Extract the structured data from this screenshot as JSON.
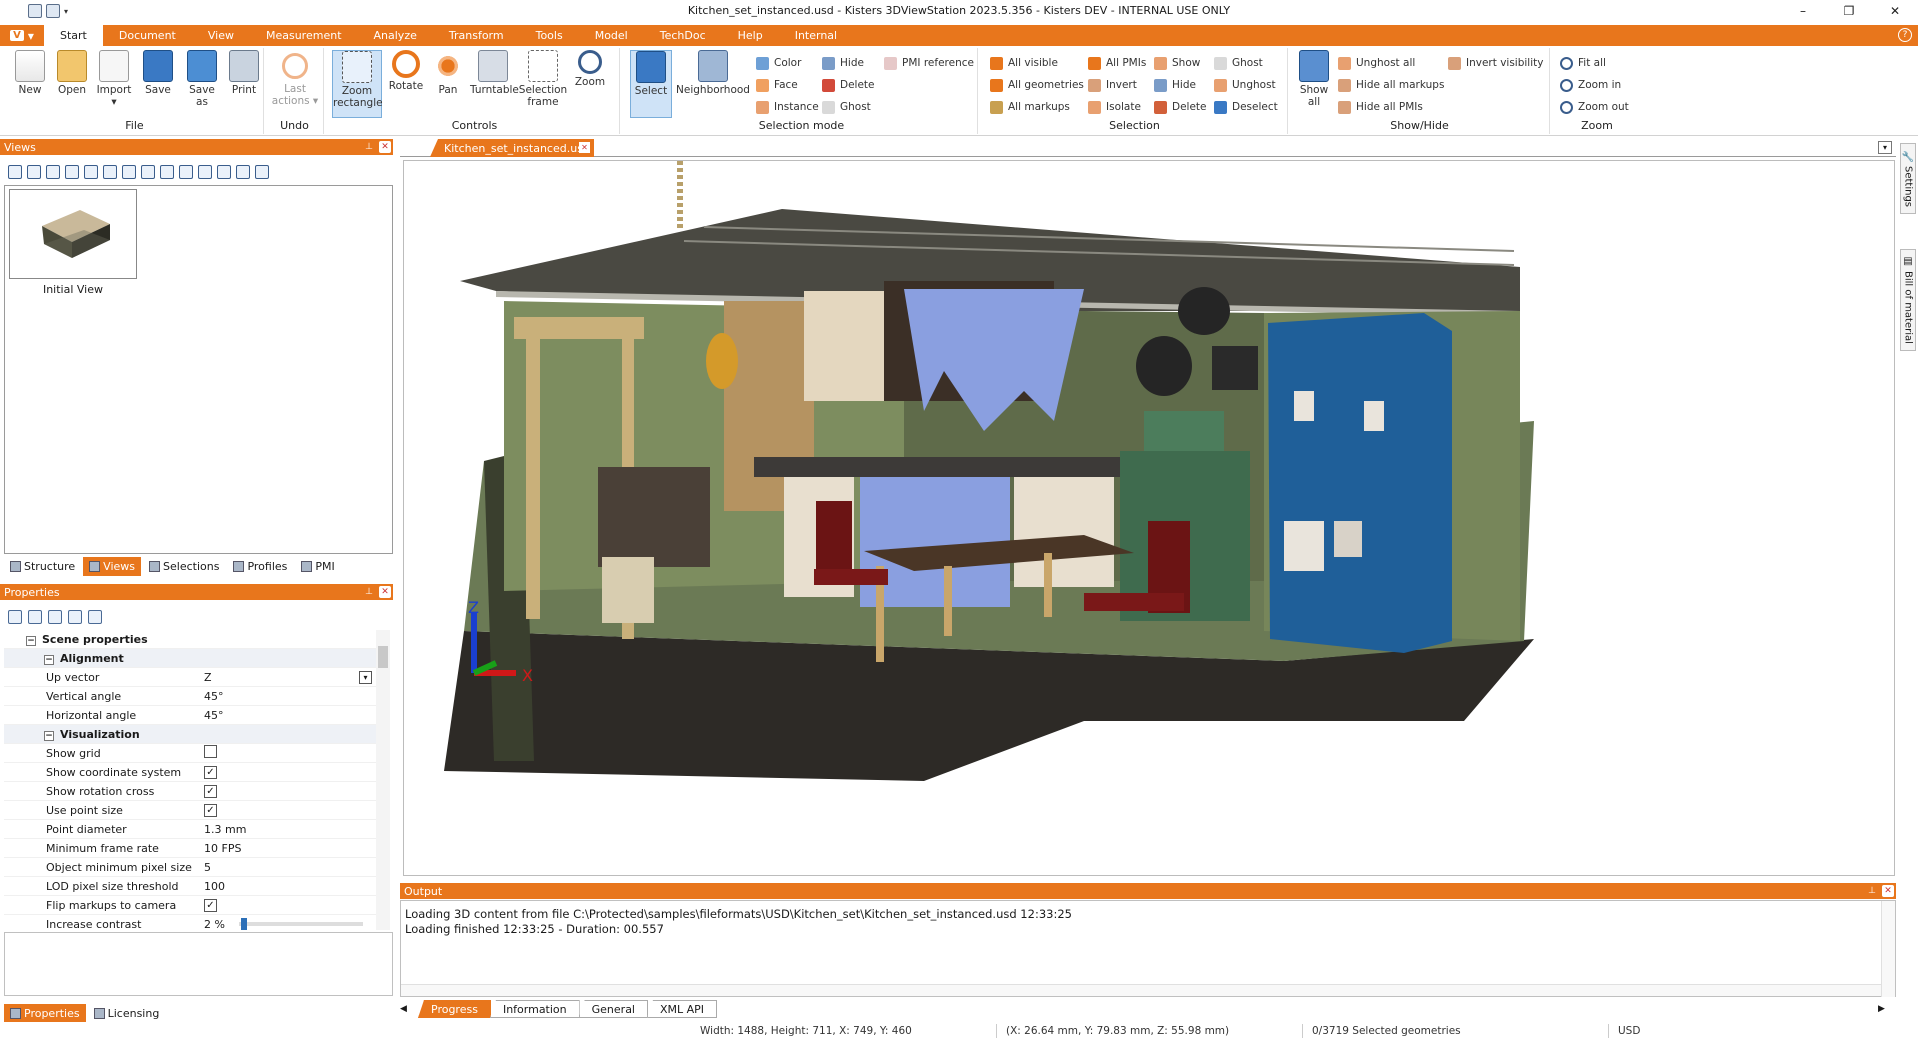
{
  "window": {
    "title": "Kitchen_set_instanced.usd - Kisters 3DViewStation 2023.5.356 - Kisters DEV - INTERNAL USE ONLY",
    "controls": [
      "–",
      "❐",
      "✕"
    ]
  },
  "ribbon": {
    "app_button": "V",
    "tabs": [
      "Start",
      "Document",
      "View",
      "Measurement",
      "Analyze",
      "Transform",
      "Tools",
      "Model",
      "TechDoc",
      "Help",
      "Internal"
    ],
    "active_tab": "Start",
    "groups": {
      "file": {
        "label": "File",
        "buttons": [
          "New",
          "Open",
          "Import",
          "Save",
          "Save as",
          "Print"
        ]
      },
      "undo": {
        "label": "Undo",
        "buttons": [
          "Last actions"
        ]
      },
      "controls": {
        "label": "Controls",
        "buttons": [
          "Zoom rectangle",
          "Rotate",
          "Pan",
          "Turntable",
          "Selection frame",
          "Zoom"
        ]
      },
      "selection_mode": {
        "label": "Selection mode",
        "big": [
          "Select",
          "Neighborhood"
        ],
        "small": [
          "Color",
          "Face",
          "Instance",
          "Hide",
          "Delete",
          "Ghost",
          "PMI reference"
        ]
      },
      "selection": {
        "label": "Selection",
        "small": [
          "All visible",
          "All geometries",
          "All markups",
          "All PMIs",
          "Invert",
          "Isolate",
          "Show",
          "Hide",
          "Delete",
          "Ghost",
          "Unghost",
          "Deselect"
        ]
      },
      "show_hide": {
        "label": "Show/Hide",
        "big": [
          "Show all"
        ],
        "small": [
          "Unghost all",
          "Hide all markups",
          "Hide all PMIs",
          "Invert visibility"
        ]
      },
      "zoom": {
        "label": "Zoom",
        "small": [
          "Fit all",
          "Zoom in",
          "Zoom out"
        ]
      }
    }
  },
  "views_panel": {
    "title": "Views",
    "thumbnail_label": "Initial View",
    "tabs": [
      "Structure",
      "Views",
      "Selections",
      "Profiles",
      "PMI"
    ],
    "active_tab": "Views"
  },
  "properties_panel": {
    "title": "Properties",
    "section": "Scene properties",
    "alignment": {
      "label": "Alignment",
      "rows": [
        {
          "key": "Up vector",
          "value": "Z"
        },
        {
          "key": "Vertical angle",
          "value": "45°"
        },
        {
          "key": "Horizontal angle",
          "value": "45°"
        }
      ]
    },
    "visualization": {
      "label": "Visualization",
      "rows": [
        {
          "key": "Show grid",
          "value": "",
          "checked": false
        },
        {
          "key": "Show coordinate system",
          "value": "",
          "checked": true
        },
        {
          "key": "Show rotation cross",
          "value": "",
          "checked": true
        },
        {
          "key": "Use point size",
          "value": "",
          "checked": true
        },
        {
          "key": "Point diameter",
          "value": "1.3 mm"
        },
        {
          "key": "Minimum frame rate",
          "value": "10 FPS"
        },
        {
          "key": "Object minimum pixel size",
          "value": "5"
        },
        {
          "key": "LOD pixel size threshold",
          "value": "100"
        },
        {
          "key": "Flip markups to camera",
          "value": "",
          "checked": true
        },
        {
          "key": "Increase contrast",
          "value": "2 %"
        }
      ]
    },
    "bottom_tabs": [
      "Properties",
      "Licensing"
    ]
  },
  "document_tab": "Kitchen_set_instanced.usd",
  "right_strip": [
    "Settings",
    "Bill of material"
  ],
  "axes": {
    "z": "Z",
    "x": "X"
  },
  "output": {
    "title": "Output",
    "lines": [
      "Loading 3D content from file C:\\Protected\\samples\\fileformats\\USD\\Kitchen_set\\Kitchen_set_instanced.usd 12:33:25",
      "Loading finished 12:33:25 - Duration: 00.557"
    ],
    "tabs": [
      "Progress",
      "Information",
      "General",
      "XML API"
    ],
    "active_tab": "Progress"
  },
  "status": {
    "dims": "Width: 1488, Height: 711, X: 749, Y: 460",
    "coords": "(X: 26.64 mm, Y: 79.83 mm, Z: 55.98 mm)",
    "selected": "0/3719 Selected geometries",
    "units": "USD"
  },
  "colors": {
    "accent": "#e8761c",
    "fridge": "#1f5f99",
    "wall": "#7a8f5c"
  }
}
